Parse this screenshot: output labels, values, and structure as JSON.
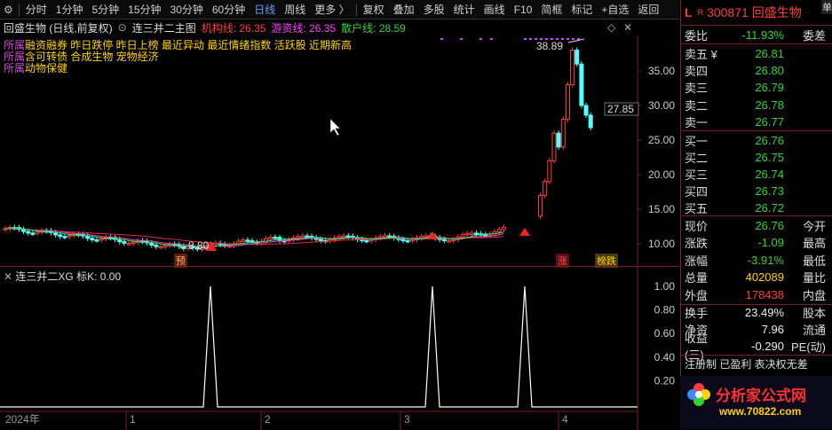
{
  "toolbar": {
    "items": [
      "分时",
      "1分钟",
      "5分钟",
      "15分钟",
      "30分钟",
      "60分钟",
      "日线",
      "周线",
      "更多 〉",
      "复权",
      "叠加",
      "多股",
      "统计",
      "画线",
      "F10",
      "简框",
      "标记",
      "+自选",
      "返回"
    ],
    "active_index": 6
  },
  "title": {
    "stock": "回盛生物 (日线,前复权)",
    "formula": "连三并二主图",
    "jg_label": "机构线: 26.35",
    "yz_label": "游资线: 26.35",
    "sh_label": "散户线: 28.59"
  },
  "concepts": {
    "prefix": "所属",
    "line1": "融资融券 昨日跌停 昨日上榜 最近异动 最近情绪指数 活跃股 近期新高",
    "line2": "含可转债 合成生物 宠物经济",
    "line3": "动物保健"
  },
  "price_axis": [
    "35.00",
    "30.00",
    "25.00",
    "20.00",
    "15.00",
    "10.00"
  ],
  "price_labels": {
    "high": "38.89",
    "low": "8.80",
    "current": "27.85"
  },
  "signals": {
    "yu": "预",
    "zhang": "涨",
    "bang": "榜跌"
  },
  "indicator": {
    "name": "连三并二XG",
    "value_label": "标K: 0.00",
    "axis": [
      "1.00",
      "0.80",
      "0.60",
      "0.40",
      "0.20"
    ]
  },
  "time_axis": [
    "2024年",
    "1",
    "2",
    "3",
    "4"
  ],
  "quote": {
    "code": "300871",
    "name": "回盛生物",
    "corner": "L",
    "badge": "R",
    "side_tab": "单",
    "weibi_label": "委比",
    "weibi_value": "-11.93%",
    "weicha_label": "委差",
    "sell": [
      {
        "label": "卖五 ¥",
        "price": "26.81"
      },
      {
        "label": "卖四",
        "price": "26.80"
      },
      {
        "label": "卖三",
        "price": "26.79"
      },
      {
        "label": "卖二",
        "price": "26.78"
      },
      {
        "label": "卖一",
        "price": "26.77"
      }
    ],
    "buy": [
      {
        "label": "买一",
        "price": "26.76"
      },
      {
        "label": "买二",
        "price": "26.75"
      },
      {
        "label": "买三",
        "price": "26.74"
      },
      {
        "label": "买四",
        "price": "26.73"
      },
      {
        "label": "买五",
        "price": "26.72"
      }
    ],
    "stats": [
      {
        "l": "现价",
        "v": "26.76",
        "e": "今开",
        "c": "green"
      },
      {
        "l": "涨跌",
        "v": "-1.09",
        "e": "最高",
        "c": "green"
      },
      {
        "l": "涨幅",
        "v": "-3.91%",
        "e": "最低",
        "c": "green"
      },
      {
        "l": "总量",
        "v": "402089",
        "e": "量比",
        "c": "yellow"
      },
      {
        "l": "外盘",
        "v": "178438",
        "e": "内盘",
        "c": "red"
      }
    ],
    "stats2": [
      {
        "l": "换手",
        "v": "23.49%",
        "e": "股本",
        "c": "white"
      },
      {
        "l": "净资",
        "v": "7.96",
        "e": "流通",
        "c": "white"
      },
      {
        "l": "收益(三)",
        "v": "-0.290",
        "e": "PE(动)",
        "c": "white"
      }
    ],
    "footer": "注册制 已盈利 表决权无差",
    "logo_text": "分析家公式网",
    "logo_url": "www.70822.com"
  },
  "colors": {
    "bg": "#000000",
    "red": "#ff3b3b",
    "green": "#2fd52f",
    "cyan": "#54ffff",
    "yellow": "#ffd400",
    "border": "#7a1d1d"
  }
}
